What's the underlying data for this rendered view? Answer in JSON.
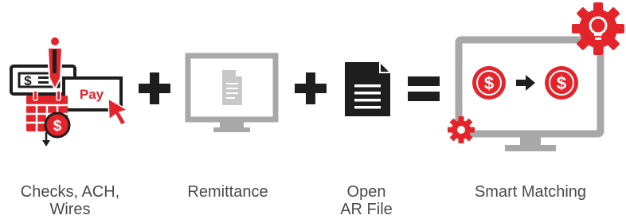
{
  "colors": {
    "accent_red": "#e3242b",
    "dark": "#1e1e1e",
    "gray": "#a8a8a8",
    "light_gray": "#c8c8c8",
    "text": "#4a4a4a"
  },
  "payments": {
    "check_symbol": "$",
    "pay_text": "Pay",
    "coin_symbol": "$",
    "icons": [
      "check-icon",
      "pen-icon",
      "pay-card-icon",
      "cursor-icon",
      "calendar-icon",
      "coin-icon"
    ]
  },
  "smart_matching": {
    "left_coin": "$",
    "right_coin": "$",
    "icons": [
      "monitor-icon",
      "gear-lightbulb-icon",
      "gear-icon",
      "arrow-right-icon"
    ]
  },
  "operators": {
    "plus_1": "+",
    "plus_2": "+",
    "equals": "="
  },
  "labels": {
    "payments_line1": "Checks, ACH,",
    "payments_line2": "Wires",
    "remittance": "Remittance",
    "ar_line1": "Open",
    "ar_line2": "AR File",
    "smart_matching": "Smart Matching"
  }
}
